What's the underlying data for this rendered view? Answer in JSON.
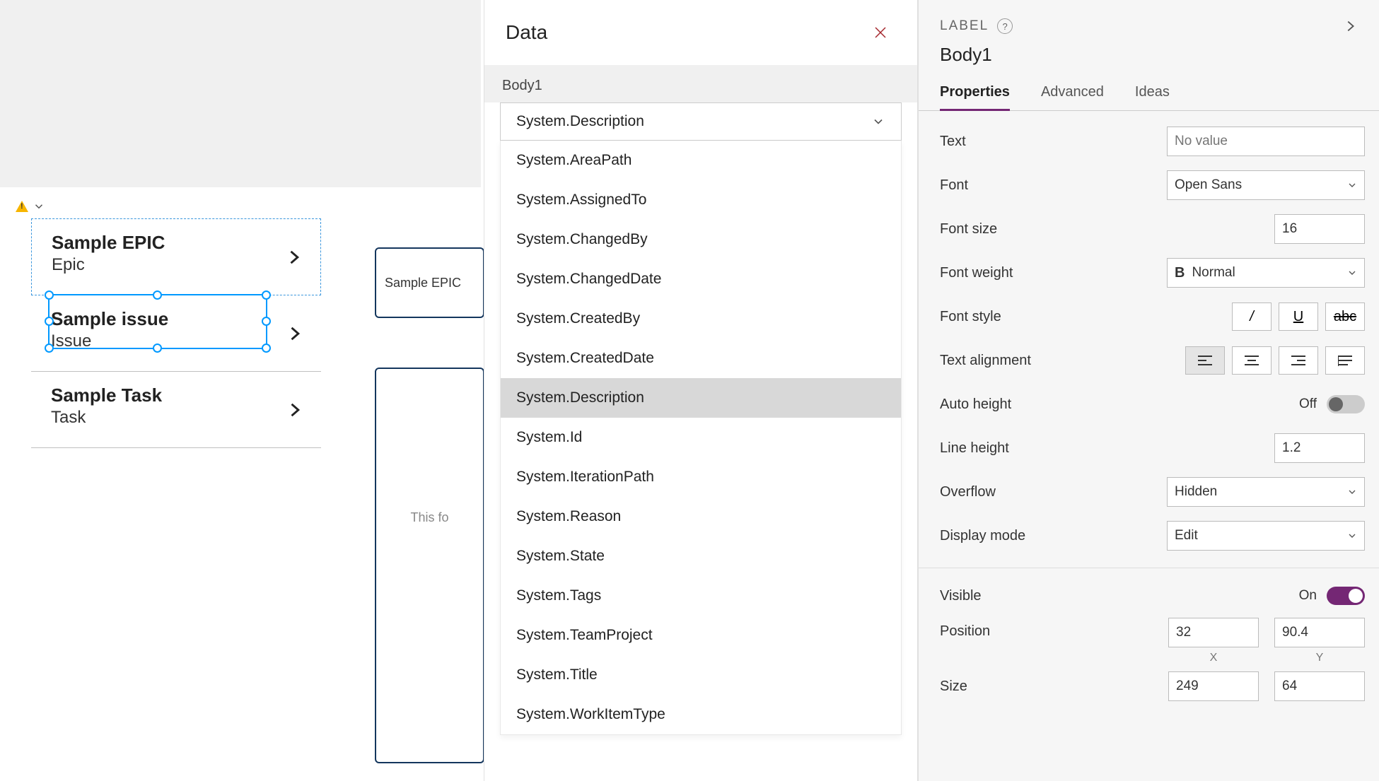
{
  "canvas": {
    "items": [
      {
        "title": "Sample EPIC",
        "subtitle": "Epic"
      },
      {
        "title": "Sample issue",
        "subtitle": "Issue"
      },
      {
        "title": "Sample Task",
        "subtitle": "Task"
      }
    ],
    "card_small": "Sample EPIC",
    "card_large": "This fo"
  },
  "data_panel": {
    "title": "Data",
    "control_name": "Body1",
    "selected": "System.Description",
    "options": [
      "System.AreaPath",
      "System.AssignedTo",
      "System.ChangedBy",
      "System.ChangedDate",
      "System.CreatedBy",
      "System.CreatedDate",
      "System.Description",
      "System.Id",
      "System.IterationPath",
      "System.Reason",
      "System.State",
      "System.Tags",
      "System.TeamProject",
      "System.Title",
      "System.WorkItemType"
    ]
  },
  "props": {
    "header_label": "LABEL",
    "control_name": "Body1",
    "tabs": {
      "properties": "Properties",
      "advanced": "Advanced",
      "ideas": "Ideas"
    },
    "rows": {
      "text_label": "Text",
      "text_placeholder": "No value",
      "font_label": "Font",
      "font_value": "Open Sans",
      "fontsize_label": "Font size",
      "fontsize_value": "16",
      "fontweight_label": "Font weight",
      "fontweight_value": "Normal",
      "fontstyle_label": "Font style",
      "textalign_label": "Text alignment",
      "autoheight_label": "Auto height",
      "autoheight_value": "Off",
      "lineheight_label": "Line height",
      "lineheight_value": "1.2",
      "overflow_label": "Overflow",
      "overflow_value": "Hidden",
      "display_label": "Display mode",
      "display_value": "Edit",
      "visible_label": "Visible",
      "visible_value": "On",
      "position_label": "Position",
      "position_x": "32",
      "position_y": "90.4",
      "x_label": "X",
      "y_label": "Y",
      "size_label": "Size",
      "size_w": "249",
      "size_h": "64"
    }
  }
}
